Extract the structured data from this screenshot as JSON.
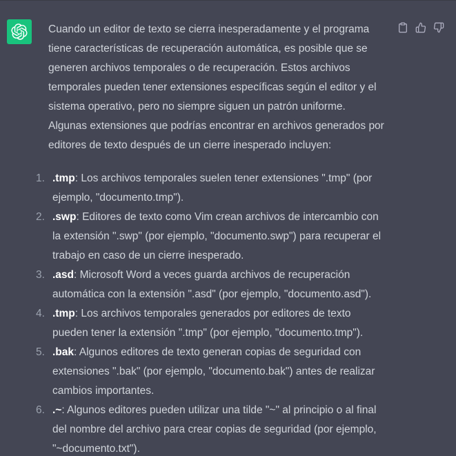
{
  "colors": {
    "background": "#444654",
    "avatar_bg": "#19c37d",
    "text": "#d1d5db",
    "bold_text": "#ffffff",
    "icon": "#acacbe"
  },
  "icons": {
    "avatar": "openai-logo-icon",
    "copy": "clipboard-icon",
    "like": "thumbs-up-icon",
    "dislike": "thumbs-down-icon"
  },
  "message": {
    "intro": "Cuando un editor de texto se cierra inesperadamente y el programa tiene características de recuperación automática, es posible que se generen archivos temporales o de recuperación. Estos archivos temporales pueden tener extensiones específicas según el editor y el sistema operativo, pero no siempre siguen un patrón uniforme. Algunas extensiones que podrías encontrar en archivos generados por editores de texto después de un cierre inesperado incluyen:",
    "items": [
      {
        "num": "1.",
        "ext": ".tmp",
        "text": ": Los archivos temporales suelen tener extensiones \".tmp\" (por ejemplo, \"documento.tmp\")."
      },
      {
        "num": "2.",
        "ext": ".swp",
        "text": ": Editores de texto como Vim crean archivos de intercambio con la extensión \".swp\" (por ejemplo, \"documento.swp\") para recuperar el trabajo en caso de un cierre inesperado."
      },
      {
        "num": "3.",
        "ext": ".asd",
        "text": ": Microsoft Word a veces guarda archivos de recuperación automática con la extensión \".asd\" (por ejemplo, \"documento.asd\")."
      },
      {
        "num": "4.",
        "ext": ".tmp",
        "text": ": Los archivos temporales generados por editores de texto pueden tener la extensión \".tmp\" (por ejemplo, \"documento.tmp\")."
      },
      {
        "num": "5.",
        "ext": ".bak",
        "text": ": Algunos editores de texto generan copias de seguridad con extensiones \".bak\" (por ejemplo, \"documento.bak\") antes de realizar cambios importantes."
      },
      {
        "num": "6.",
        "ext": ".~",
        "text": ": Algunos editores pueden utilizar una tilde \"~\" al principio o al final del nombre del archivo para crear copias de seguridad (por ejemplo, \"~documento.txt\")."
      }
    ]
  }
}
